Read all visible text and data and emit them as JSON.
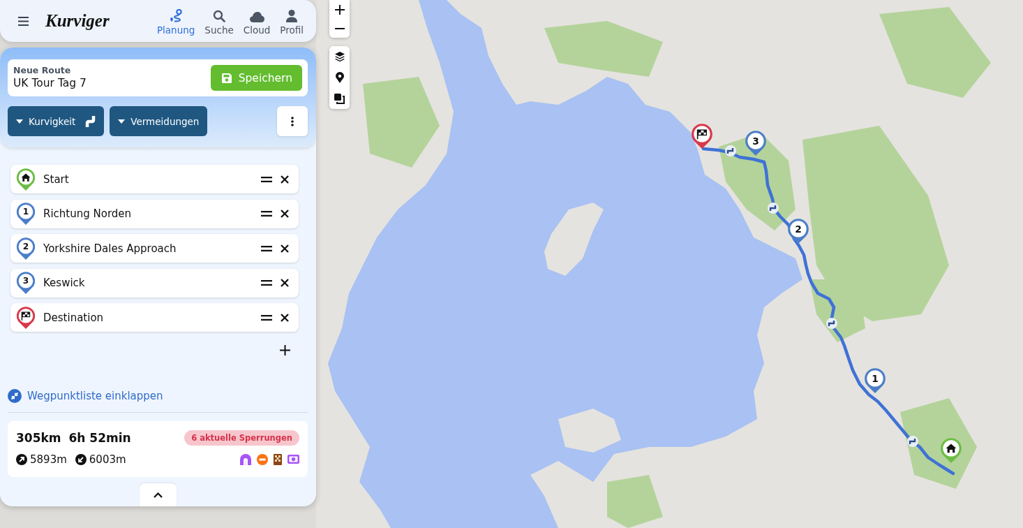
{
  "header": {
    "logo": "Kurviger",
    "nav": [
      {
        "kind": "route",
        "label": "Planung",
        "selected": true
      },
      {
        "kind": "search",
        "label": "Suche",
        "selected": false
      },
      {
        "kind": "cloud",
        "label": "Cloud",
        "selected": false
      },
      {
        "kind": "profile",
        "label": "Profil",
        "selected": false
      }
    ]
  },
  "route": {
    "label": "Neue Route",
    "name": "UK Tour Tag 7",
    "save": "Speichern"
  },
  "options": [
    {
      "kind": "curviness",
      "label": "Kurvigkeit"
    },
    {
      "kind": "avoid",
      "label": "Vermeidungen"
    }
  ],
  "waypoints": [
    {
      "kind": "start",
      "name": "Start"
    },
    {
      "kind": "via",
      "number": "1",
      "name": "Richtung Norden"
    },
    {
      "kind": "via",
      "number": "2",
      "name": "Yorkshire Dales Approach"
    },
    {
      "kind": "via",
      "number": "3",
      "name": "Keswick"
    },
    {
      "kind": "destination",
      "name": "Destination"
    }
  ],
  "collapse_link": "Wegpunktliste einklappen",
  "summary": {
    "distance": "305km",
    "duration": "6h 52min",
    "closures": "6 aktuelle Sperrungen",
    "ascent": "5893m",
    "descent": "6003m"
  },
  "map": {
    "markers": [
      {
        "kind": "start"
      },
      {
        "kind": "via",
        "number": "1"
      },
      {
        "kind": "via",
        "number": "2"
      },
      {
        "kind": "via",
        "number": "3"
      },
      {
        "kind": "destination"
      }
    ]
  }
}
